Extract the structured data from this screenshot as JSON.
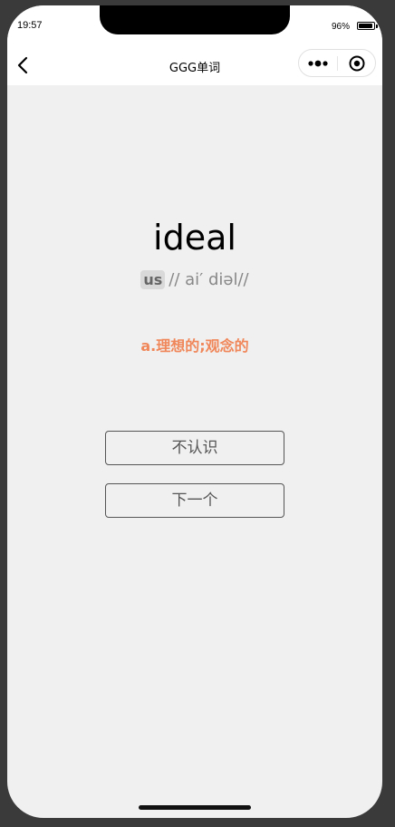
{
  "status_bar": {
    "time": "19:57",
    "battery_percent": "96%",
    "battery_level": 0.96
  },
  "nav": {
    "title": "GGG单词",
    "back_icon": "chevron-left-icon",
    "more_icon": "more-dots-icon",
    "close_icon": "target-close-icon"
  },
  "card": {
    "word": "ideal",
    "accent_label": "us",
    "phonetic": "// ai′ diəl//",
    "meaning": "a.理想的;观念的"
  },
  "actions": {
    "unknown_label": "不认识",
    "next_label": "下一个"
  },
  "colors": {
    "meaning": "#f0875a",
    "background": "#f0f0f0"
  }
}
